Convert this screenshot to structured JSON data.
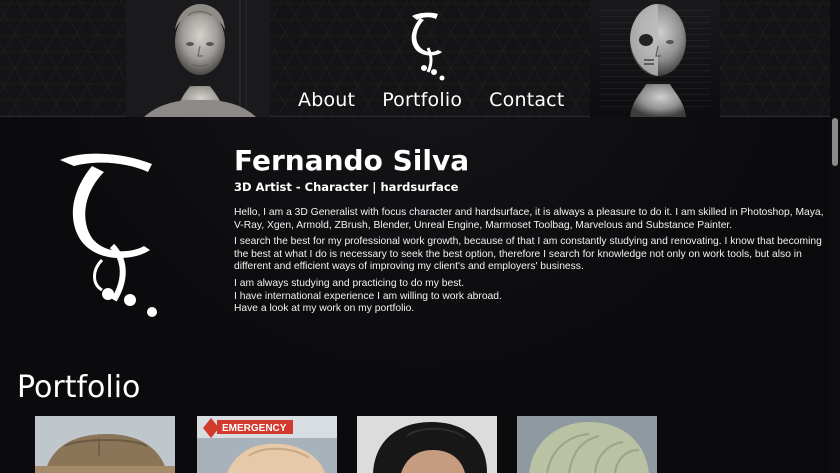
{
  "nav": {
    "items": [
      {
        "label": "About"
      },
      {
        "label": "Portfolio"
      },
      {
        "label": "Contact"
      }
    ]
  },
  "about": {
    "name": "Fernando Silva",
    "role": "3D Artist - Character | hardsurface",
    "paragraphs": [
      "Hello, I am a 3D Generalist with focus character and hardsurface, it is always a pleasure to do it. I am skilled in Photoshop, Maya, V-Ray, Xgen, Armold, ZBrush, Blender, Unreal Engine, Marmoset Toolbag, Marvelous and Substance Painter.",
      "I search the best for my professional work growth, because of that I am constantly studying and renovating. I know that becoming the best at what I do is necessary to seek the best option, therefore I search for knowledge not only on work tools, but also in different and efficient ways of improving my client's and employers' business.",
      "I am always studying and practicing to do my best.",
      "I have international experience I am willing to work abroad.",
      "Have a look at my work on my portfolio."
    ]
  },
  "portfolio": {
    "heading": "Portfolio",
    "thumb_sign_text": "EMERGENCY"
  }
}
